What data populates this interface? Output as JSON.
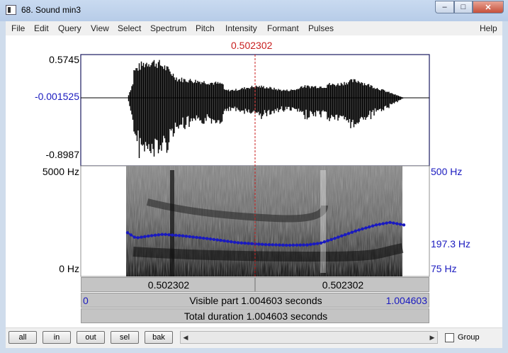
{
  "window": {
    "title": "68. Sound min3",
    "min": "–",
    "max": "□",
    "close": "✕"
  },
  "menu": [
    "File",
    "Edit",
    "Query",
    "View",
    "Select",
    "Spectrum",
    "Pitch",
    "Intensity",
    "Formant",
    "Pulses"
  ],
  "menu_help": "Help",
  "cursor_time": "0.502302",
  "waveform": {
    "max": "0.5745",
    "center": "-0.001525",
    "min": "-0.8987"
  },
  "spectrogram": {
    "top_left": "5000 Hz",
    "bottom_left": "0 Hz",
    "top_right": "500 Hz",
    "mid_right": "197.3 Hz",
    "bottom_right": "75 Hz"
  },
  "time_bar": {
    "left_time": "0.502302",
    "right_time": "0.502302"
  },
  "visible_bar": {
    "start": "0",
    "label": "Visible part 1.004603 seconds",
    "end": "1.004603"
  },
  "total_bar": {
    "label": "Total duration 1.004603 seconds"
  },
  "toolbar": {
    "all": "all",
    "in": "in",
    "out": "out",
    "sel": "sel",
    "bak": "bak",
    "group": "Group",
    "left_arrow": "◀",
    "right_arrow": "▶"
  },
  "colors": {
    "pitch": "#1a1abf",
    "cursor": "#c81e1e"
  },
  "pitch_curve": {
    "unit": "Hz",
    "range": [
      75,
      500
    ],
    "points": [
      [
        0.0,
        215
      ],
      [
        0.03,
        198
      ],
      [
        0.08,
        205
      ],
      [
        0.13,
        210
      ],
      [
        0.2,
        205
      ],
      [
        0.3,
        195
      ],
      [
        0.4,
        183
      ],
      [
        0.5,
        177
      ],
      [
        0.58,
        175
      ],
      [
        0.65,
        176
      ],
      [
        0.7,
        182
      ],
      [
        0.76,
        200
      ],
      [
        0.83,
        222
      ],
      [
        0.9,
        240
      ],
      [
        0.95,
        248
      ],
      [
        1.0,
        240
      ]
    ]
  }
}
